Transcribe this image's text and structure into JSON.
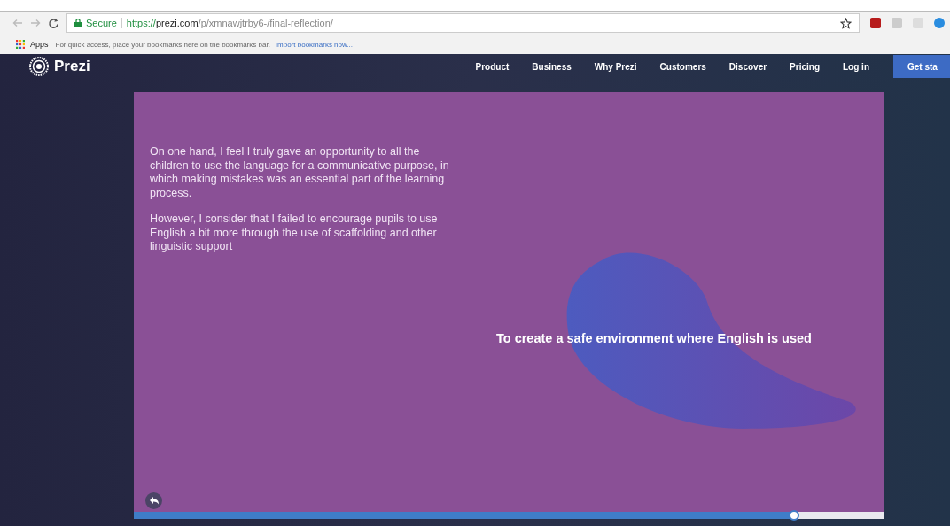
{
  "browser": {
    "secure_label": "Secure",
    "url": {
      "scheme": "https://",
      "host": "prezi.com",
      "path": "/p/xmnawjtrby6-/final-reflection/"
    },
    "bookmarks": {
      "apps": "Apps",
      "hint": "For quick access, place your bookmarks here on the bookmarks bar.",
      "import_link": "Import bookmarks now..."
    }
  },
  "site_nav": {
    "logo": "Prezi",
    "items": [
      {
        "label": "Product"
      },
      {
        "label": "Business"
      },
      {
        "label": "Why Prezi"
      },
      {
        "label": "Customers"
      },
      {
        "label": "Discover"
      },
      {
        "label": "Pricing"
      },
      {
        "label": "Log in"
      }
    ],
    "cta": "Get sta"
  },
  "slide": {
    "paragraphs": [
      "On one hand, I feel I truly gave an opportunity to all the children to use the language for a communicative purpose, in which making mistakes was an essential part of the learning process.",
      "However, I consider that I failed to encourage pupils to use English a bit more through the use of scaffolding and other linguistic support"
    ],
    "heading": "To create a safe environment where English is used"
  },
  "progress": {
    "level": 0.88
  }
}
